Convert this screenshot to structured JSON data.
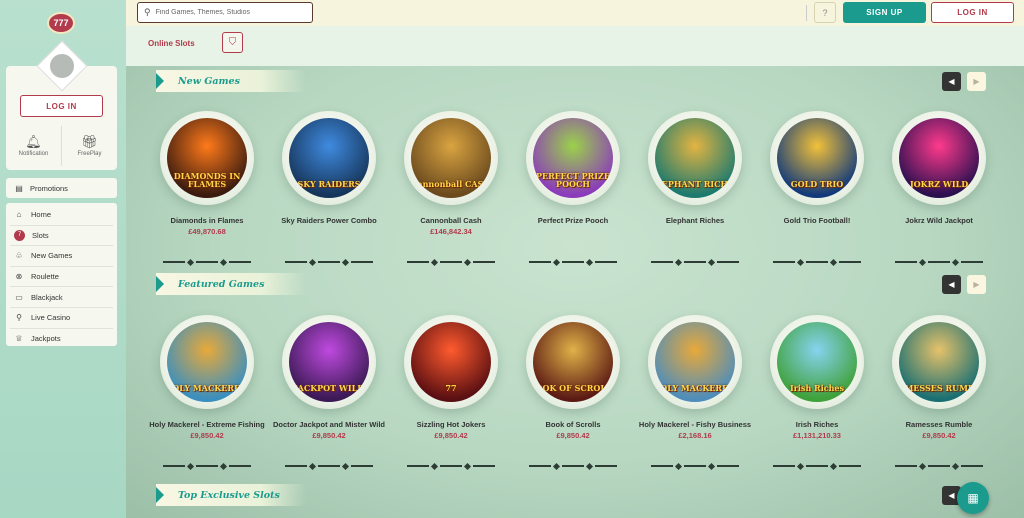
{
  "sidebar": {
    "logo": "777",
    "login_label": "LOG IN",
    "notifications_label": "Notification",
    "freeplay_label": "FreePlay",
    "promotions_label": "Promotions",
    "nav": [
      {
        "label": "Home",
        "icon": "home-icon",
        "glyph": "⌂"
      },
      {
        "label": "Slots",
        "icon": "slots-icon",
        "glyph": "7"
      },
      {
        "label": "New Games",
        "icon": "new-games-icon",
        "glyph": "♧"
      },
      {
        "label": "Roulette",
        "icon": "roulette-icon",
        "glyph": "⊗"
      },
      {
        "label": "Blackjack",
        "icon": "blackjack-icon",
        "glyph": "▭"
      },
      {
        "label": "Live Casino",
        "icon": "live-casino-icon",
        "glyph": "⚲"
      },
      {
        "label": "Jackpots",
        "icon": "jackpots-icon",
        "glyph": "♕"
      }
    ]
  },
  "header": {
    "search_placeholder": "Find Games, Themes, Studios",
    "help_label": "?",
    "signup_label": "SIGN UP",
    "login_label": "LOG IN"
  },
  "subbar": {
    "title": "Online Slots"
  },
  "sections": {
    "new_games": {
      "title": "New Games",
      "games": [
        {
          "name": "Diamonds in Flames",
          "price": "£49,870.68",
          "logo": "DIAMONDS IN FLAMES",
          "bg": "#3a1b10",
          "accent": "#ff7a1a"
        },
        {
          "name": "Sky Raiders Power Combo",
          "price": "",
          "logo": "SKY RAIDERS",
          "bg": "#16355a",
          "accent": "#3f8be0"
        },
        {
          "name": "Cannonball Cash",
          "price": "£146,842.34",
          "logo": "Cannonball CASH",
          "bg": "#6b4a1e",
          "accent": "#d9a441"
        },
        {
          "name": "Perfect Prize Pooch",
          "price": "",
          "logo": "PERFECT PRIZE POOCH",
          "bg": "#8b3bbb",
          "accent": "#9bd24a"
        },
        {
          "name": "Elephant Riches",
          "price": "",
          "logo": "ELEPHANT RICHES",
          "bg": "#1d7a6e",
          "accent": "#e3b442"
        },
        {
          "name": "Gold Trio Football!",
          "price": "",
          "logo": "GOLD TRIO",
          "bg": "#123a7a",
          "accent": "#f2c13a"
        },
        {
          "name": "Jokrz Wild Jackpot",
          "price": "",
          "logo": "JOKRZ WILD",
          "bg": "#2b1050",
          "accent": "#ff3a8c"
        }
      ]
    },
    "featured_games": {
      "title": "Featured Games",
      "games": [
        {
          "name": "Holy Mackerel - Extreme Fishing",
          "price": "£9,850.42",
          "logo": "HOLY MACKEREL!",
          "bg": "#3a8fbf",
          "accent": "#e8a93a"
        },
        {
          "name": "Doctor Jackpot and Mister Wild",
          "price": "£9,850.42",
          "logo": "JACKPOT WILD",
          "bg": "#3b1a55",
          "accent": "#c04ae0"
        },
        {
          "name": "Sizzling Hot Jokers",
          "price": "£9,850.42",
          "logo": "77",
          "bg": "#5a0f12",
          "accent": "#ff5b2e"
        },
        {
          "name": "Book of Scrolls",
          "price": "£9,850.42",
          "logo": "BOOK OF SCROLLS",
          "bg": "#5c1a14",
          "accent": "#e0b248"
        },
        {
          "name": "Holy Mackerel - Fishy Business",
          "price": "£2,168.16",
          "logo": "HOLY MACKEREL!",
          "bg": "#4e8dbb",
          "accent": "#e8a93a"
        },
        {
          "name": "Irish Riches",
          "price": "£1,131,210.33",
          "logo": "Irish Riches",
          "bg": "#3fa13a",
          "accent": "#86d3f0"
        },
        {
          "name": "Ramesses Rumble",
          "price": "£9,850.42",
          "logo": "RAMESSES RUMBLE",
          "bg": "#1a6f72",
          "accent": "#e6c26a"
        }
      ]
    },
    "top_exclusive": {
      "title": "Top Exclusive Slots"
    }
  }
}
